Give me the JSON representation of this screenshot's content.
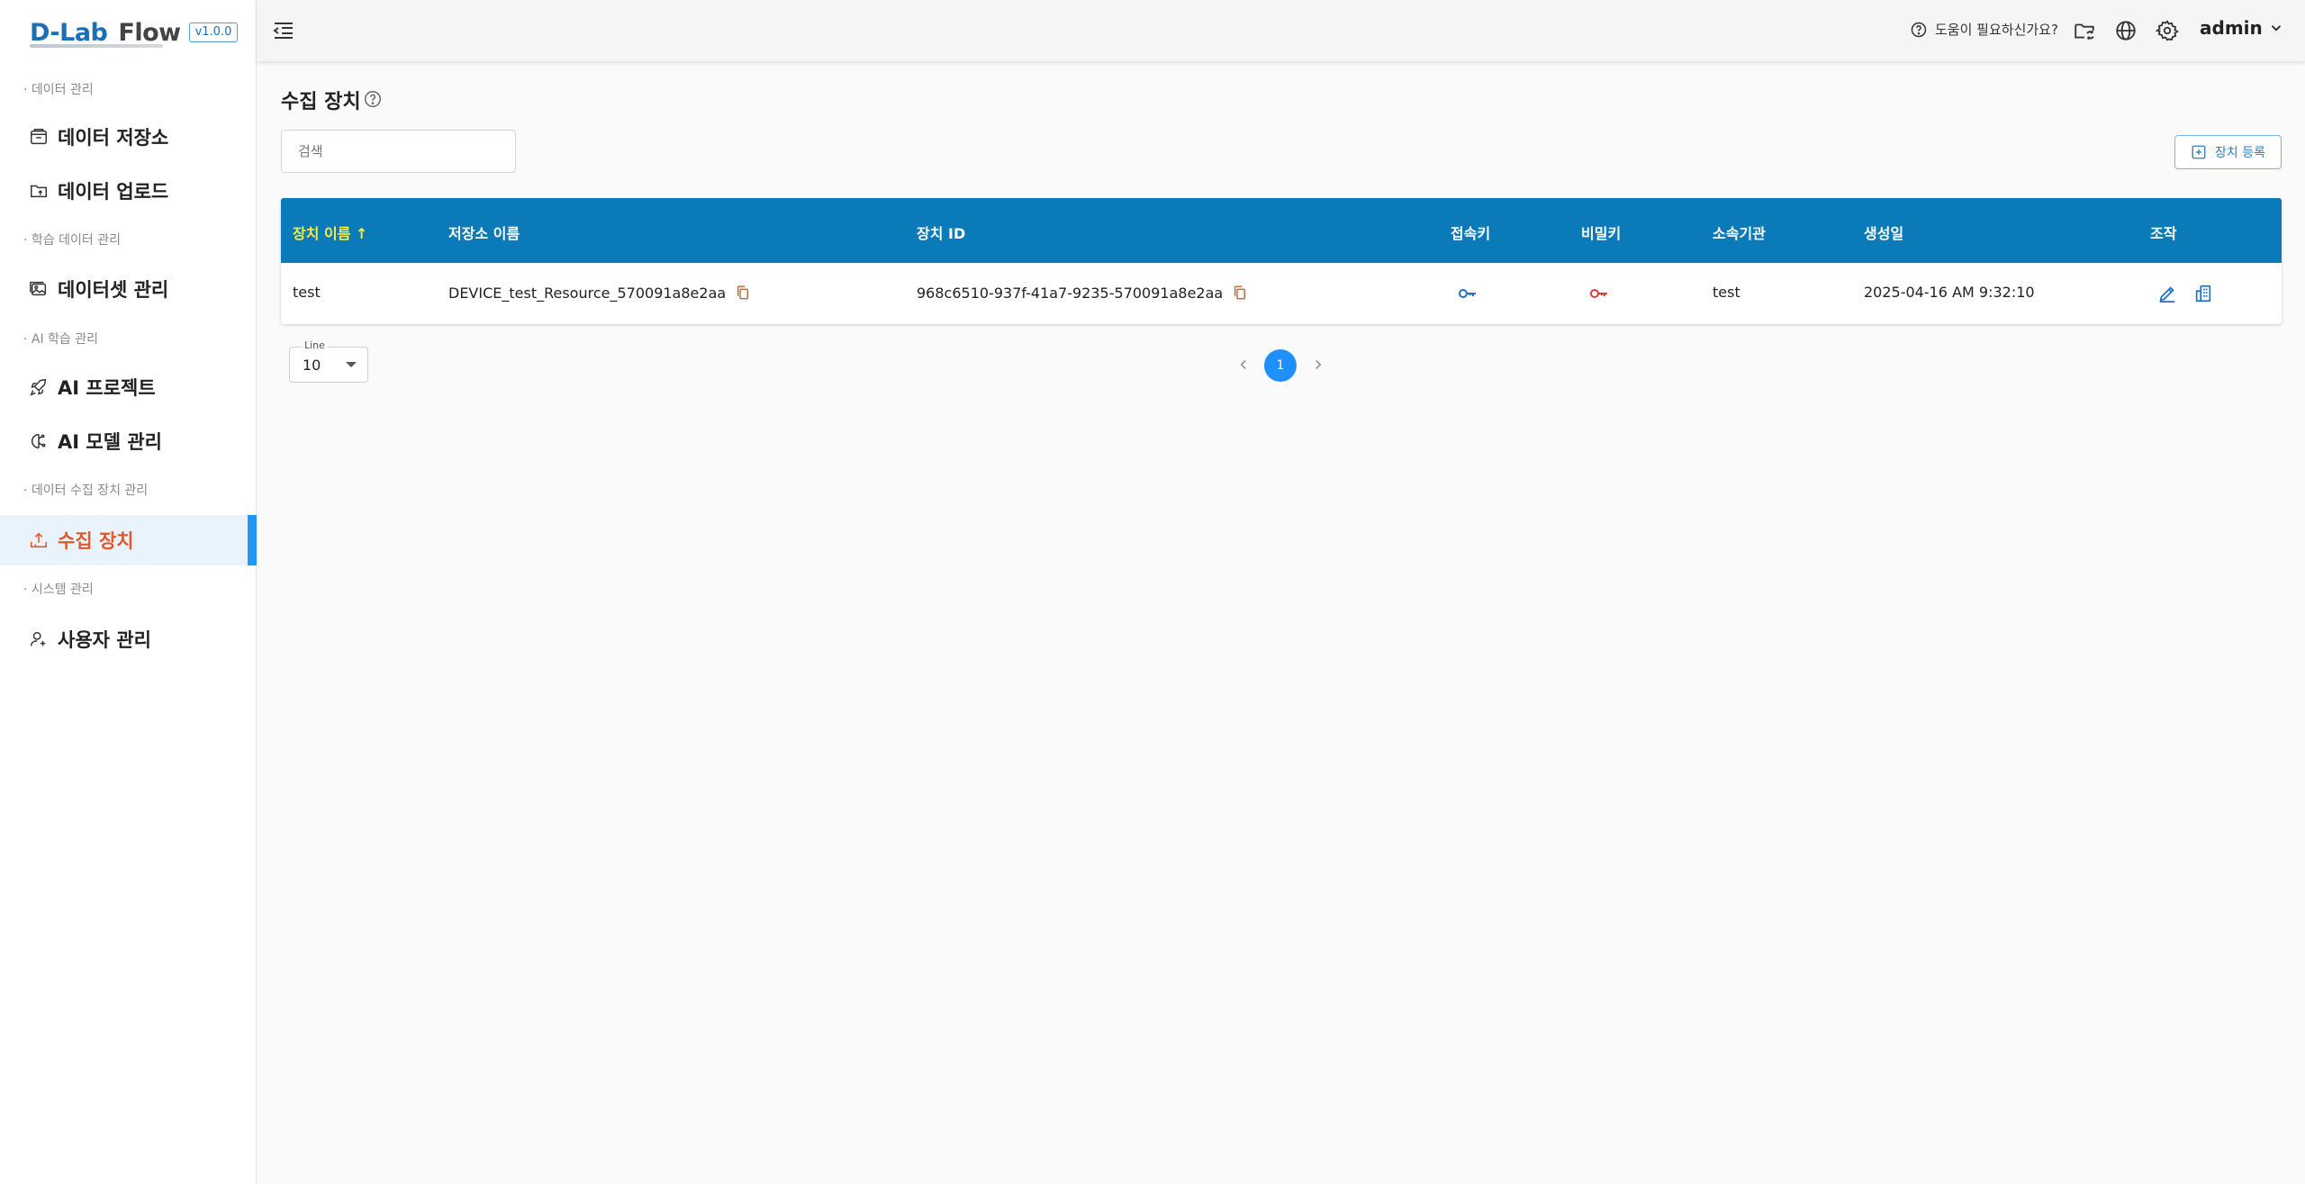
{
  "brand": {
    "name_part1": "D-Lab",
    "name_part2": "Flow",
    "version": "v1.0.0"
  },
  "sidebar": {
    "sections": [
      {
        "label": "· 데이터 관리"
      },
      {
        "label": "· 학습 데이터 관리"
      },
      {
        "label": "· AI 학습 관리"
      },
      {
        "label": "· 데이터 수집 장치 관리"
      },
      {
        "label": "· 시스템 관리"
      }
    ],
    "items": [
      {
        "label": "데이터 저장소",
        "icon": "storage-box-icon"
      },
      {
        "label": "데이터 업로드",
        "icon": "folder-upload-icon"
      },
      {
        "label": "데이터셋 관리",
        "icon": "image-gallery-icon"
      },
      {
        "label": "AI 프로젝트",
        "icon": "rocket-icon"
      },
      {
        "label": "AI 모델 관리",
        "icon": "brain-icon"
      },
      {
        "label": "수집 장치",
        "icon": "upload-tray-icon",
        "active": true
      },
      {
        "label": "사용자 관리",
        "icon": "user-add-icon"
      }
    ]
  },
  "header": {
    "help_text": "도움이 필요하신가요?",
    "user_name": "admin",
    "icons": [
      "help-circle-icon",
      "folder-sync-icon",
      "globe-icon",
      "gear-icon",
      "chevron-down-icon"
    ]
  },
  "main": {
    "title": "수집 장치",
    "search_placeholder": "검색",
    "register_label": "장치 등록"
  },
  "table": {
    "columns": [
      "장치 이름 ↑",
      "저장소 이름",
      "장치 ID",
      "접속키",
      "비밀키",
      "소속기관",
      "생성일",
      "조작"
    ],
    "rows": [
      {
        "name": "test",
        "storage": "DEVICE_test_Resource_570091a8e2aa",
        "device_id": "968c6510-937f-41a7-9235-570091a8e2aa",
        "org": "test",
        "created": "2025-04-16 AM 9:32:10"
      }
    ]
  },
  "pagination": {
    "line_label": "Line",
    "line_value": "10",
    "current_page": "1"
  },
  "colors": {
    "accent": "#0a7bb8",
    "active_text": "#e3582a",
    "active_bar": "#2196f3",
    "sort_highlight": "#ffeb3b",
    "secret_key": "#e53935",
    "access_key": "#1e6fd0"
  }
}
